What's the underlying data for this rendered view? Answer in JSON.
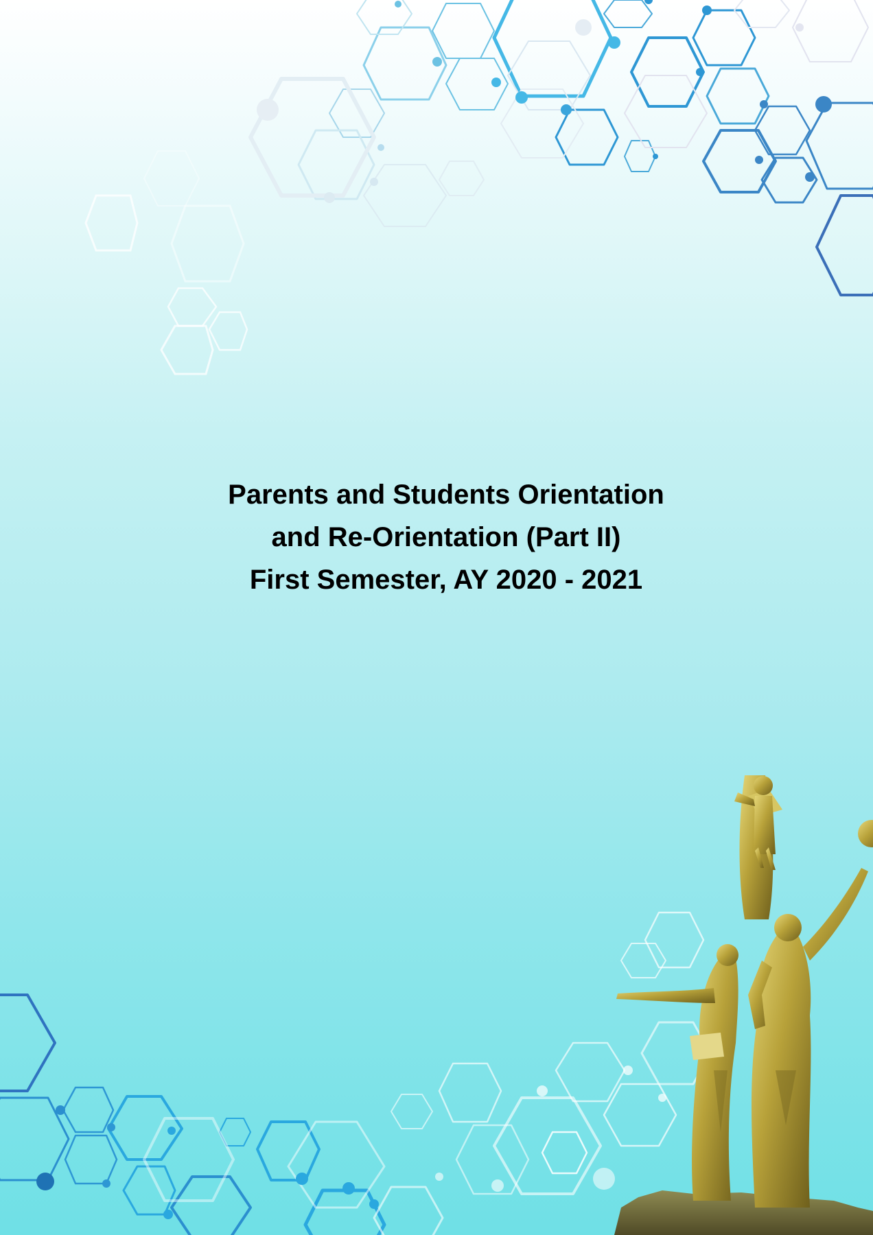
{
  "cover": {
    "title_lines": [
      "Parents and Students Orientation",
      "and Re-Orientation (Part II)",
      "First Semester, AY 2020 - 2021"
    ]
  },
  "colors": {
    "hex_dark_blue": "#3b7fc4",
    "hex_mid_blue": "#2aa8df",
    "hex_light_blue": "#7ccbe8",
    "statue_gold": "#b8a23a"
  }
}
